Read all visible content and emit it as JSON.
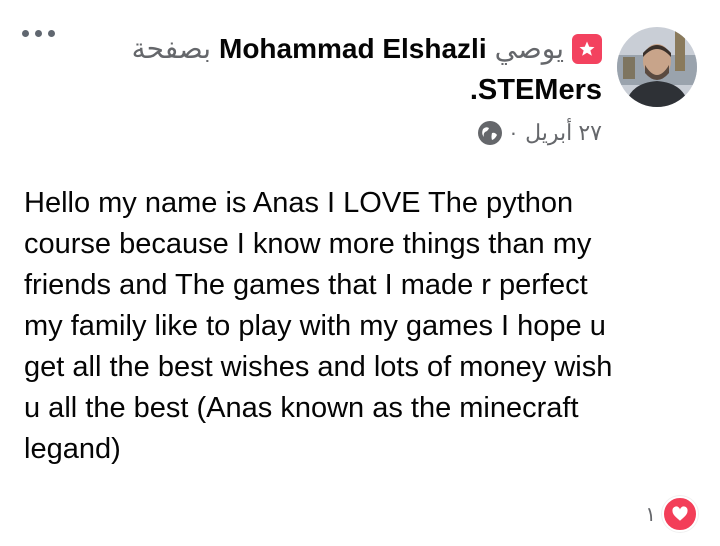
{
  "header": {
    "recommends_word": "يوصي",
    "author_name": "Mohammad Elshazli",
    "page_prefix": "بصفحة",
    "page_name": "STEMers",
    "trailing_period": ".",
    "date": "٢٧ أبريل",
    "separator": "·"
  },
  "post": {
    "text": "Hello my name is Anas I LOVE The python\ncourse because I know more things than my\nfriends and The games that I made r perfect\nmy family like to play with my games I hope u\nget all the best wishes and lots of money wish\nu all the best       (Anas known as the minecraft\nlegand)"
  },
  "reactions": {
    "count": "١",
    "type_icon": "love-icon"
  },
  "icons": {
    "more": "more-options-icon",
    "recommend": "recommend-star-icon",
    "audience": "globe-icon"
  },
  "colors": {
    "love": "#f33e58",
    "recommend": "#f3425f",
    "muted": "#65676b"
  }
}
